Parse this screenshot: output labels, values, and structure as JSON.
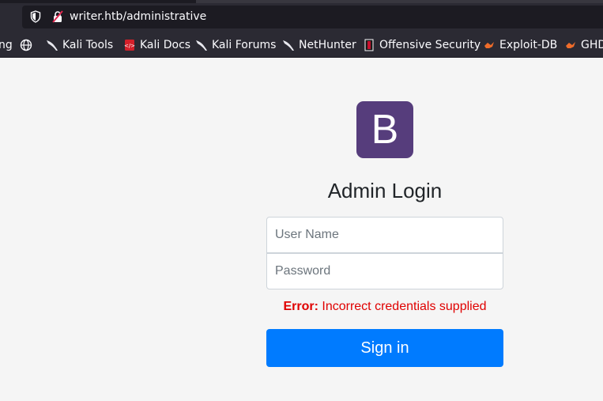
{
  "browser": {
    "url": "writer.htb/administrative",
    "bookmarks": [
      {
        "label": "ng",
        "icon": "partial-bookmark-icon"
      },
      {
        "label": "",
        "icon": "globe-icon"
      },
      {
        "label": "Kali Tools",
        "icon": "kali-dragon-icon"
      },
      {
        "label": "Kali Docs",
        "icon": "kali-docs-icon"
      },
      {
        "label": "Kali Forums",
        "icon": "kali-dragon-icon"
      },
      {
        "label": "NetHunter",
        "icon": "kali-dragon-icon"
      },
      {
        "label": "Offensive Security",
        "icon": "offsec-icon"
      },
      {
        "label": "Exploit-DB",
        "icon": "exploitdb-icon"
      },
      {
        "label": "GHD",
        "icon": "exploitdb-icon"
      }
    ]
  },
  "login": {
    "logo_letter": "B",
    "title": "Admin Login",
    "username_placeholder": "User Name",
    "password_placeholder": "Password",
    "error_label": "Error:",
    "error_message": " Incorrect credentials supplied",
    "submit_label": "Sign in"
  },
  "colors": {
    "logo_bg": "#563d7c",
    "button_bg": "#007bff",
    "error": "#e00000",
    "page_bg": "#f5f5f5",
    "browser_bg": "#2b2a33"
  }
}
